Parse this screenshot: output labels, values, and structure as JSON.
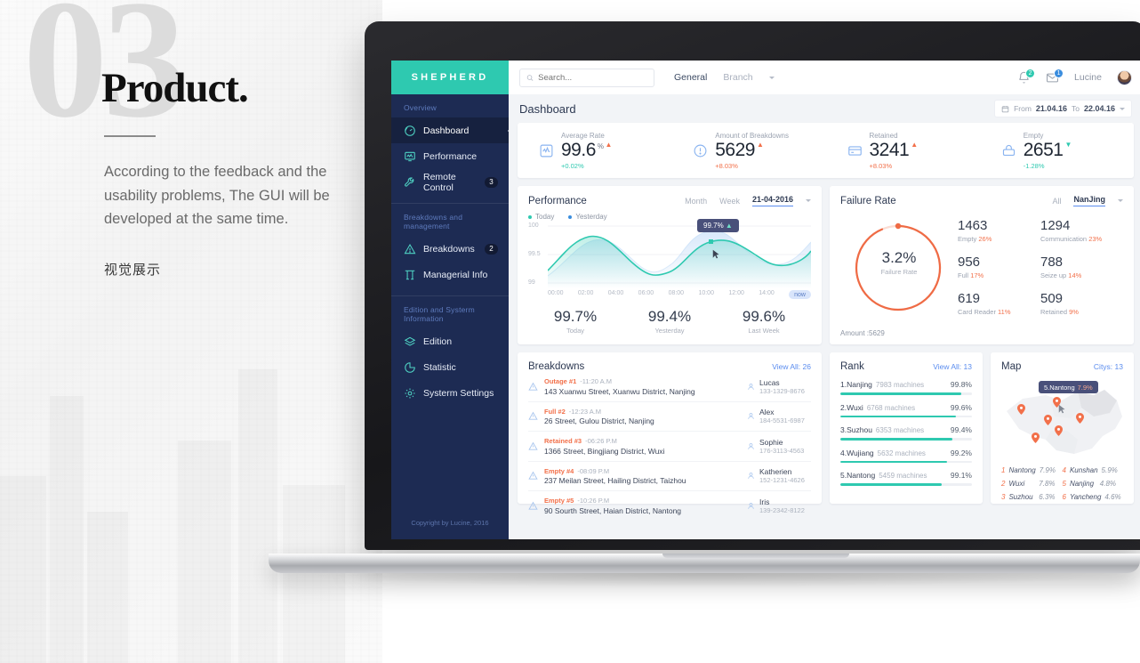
{
  "promo": {
    "number": "03",
    "title": "Product.",
    "body": "According to the feedback and the usability problems, The GUI will be developed at the same time.",
    "subtitle_cn": "视觉展示"
  },
  "sidebar": {
    "brand": "SHEPHERD",
    "groups": [
      {
        "label": "Overview",
        "items": [
          {
            "label": "Dashboard",
            "icon": "gauge-icon",
            "active": true,
            "badge": ""
          },
          {
            "label": "Performance",
            "icon": "monitor-chart-icon",
            "active": false,
            "badge": ""
          },
          {
            "label": "Remote Control",
            "icon": "wrench-icon",
            "active": false,
            "badge": "3"
          }
        ]
      },
      {
        "label": "Breakdowns and management",
        "items": [
          {
            "label": "Breakdowns",
            "icon": "warning-triangle-icon",
            "active": false,
            "badge": "2"
          },
          {
            "label": "Managerial Info",
            "icon": "columns-icon",
            "active": false,
            "badge": ""
          }
        ]
      },
      {
        "label": "Edition and Systerm Information",
        "items": [
          {
            "label": "Edition",
            "icon": "layers-icon",
            "active": false,
            "badge": ""
          },
          {
            "label": "Statistic",
            "icon": "pie-chart-icon",
            "active": false,
            "badge": ""
          },
          {
            "label": "Systerm Settings",
            "icon": "gear-icon",
            "active": false,
            "badge": ""
          }
        ]
      }
    ],
    "copyright": "Copyright by Lucine, 2016"
  },
  "topbar": {
    "search_placeholder": "Search...",
    "tabs": [
      {
        "label": "General",
        "active": true
      },
      {
        "label": "Branch",
        "active": false
      }
    ],
    "bell_badge": "2",
    "mail_badge": "1",
    "user": "Lucine"
  },
  "pagehead": {
    "title": "Dashboard",
    "from_label": "From",
    "from_value": "21.04.16",
    "to_label": "To",
    "to_value": "22.04.16"
  },
  "kpis": [
    {
      "label": "Average Rate",
      "value": "99.6",
      "unit": "%",
      "arrow": "▲",
      "arrow_color": "#f2704a",
      "delta": "+0.02%",
      "delta_color": "#2ec9b0",
      "icon": "pulse-box-icon"
    },
    {
      "label": "Amount of Breakdowns",
      "value": "5629",
      "unit": "",
      "arrow": "▲",
      "arrow_color": "#f2704a",
      "delta": "+8.03%",
      "delta_color": "#f2704a",
      "icon": "alert-circle-icon"
    },
    {
      "label": "Retained",
      "value": "3241",
      "unit": "",
      "arrow": "▲",
      "arrow_color": "#f2704a",
      "delta": "+8.03%",
      "delta_color": "#f2704a",
      "icon": "card-icon"
    },
    {
      "label": "Empty",
      "value": "2651",
      "unit": "",
      "arrow": "▼",
      "arrow_color": "#2ec9b0",
      "delta": "-1.28%",
      "delta_color": "#2ec9b0",
      "icon": "atm-icon"
    }
  ],
  "performance": {
    "title": "Performance",
    "segments": [
      {
        "label": "Month",
        "active": false
      },
      {
        "label": "Week",
        "active": false
      },
      {
        "label": "21-04-2016",
        "active": true
      }
    ],
    "legend": [
      {
        "label": "Today",
        "color": "#2ec9b0"
      },
      {
        "label": "Yesterday",
        "color": "#5b8def"
      }
    ],
    "tooltip": "99.7%",
    "tooltip_arrow": "▲",
    "now_label": "now",
    "stats": [
      {
        "value": "99.7%",
        "label": "Today"
      },
      {
        "value": "99.4%",
        "label": "Yesterday"
      },
      {
        "value": "99.6%",
        "label": "Last Week"
      }
    ],
    "chart_data": {
      "type": "line",
      "title": "Performance",
      "xlabel": "",
      "ylabel": "",
      "ylim": [
        99,
        100
      ],
      "grid": true,
      "legend_position": "top-left",
      "ticks_y": [
        "100",
        "99.5",
        "99"
      ],
      "x": [
        "00:00",
        "02:00",
        "04:00",
        "06:00",
        "08:00",
        "10:00",
        "12:00",
        "14:00"
      ],
      "series": [
        {
          "name": "Today",
          "color": "#2ec9b0",
          "values": [
            99.32,
            99.68,
            99.82,
            99.7,
            99.42,
            99.28,
            99.55,
            99.73,
            99.8,
            99.76,
            99.56,
            99.4,
            99.43,
            99.52,
            99.66
          ]
        },
        {
          "name": "Yesterday",
          "color": "#5b8def",
          "values": [
            99.12,
            99.28,
            99.48,
            99.55,
            99.45,
            99.3,
            99.35,
            99.62,
            99.86,
            99.88,
            99.8,
            99.58,
            99.4,
            99.38,
            99.64
          ]
        }
      ],
      "annotation": {
        "label": "99.7%",
        "x": "10:00",
        "y": 99.7
      }
    }
  },
  "failure": {
    "title": "Failure Rate",
    "segments": [
      {
        "label": "All",
        "active": false
      },
      {
        "label": "NanJing",
        "active": true
      }
    ],
    "rate": "3.2%",
    "rate_label": "Failure Rate",
    "amount": "Amount :5629",
    "chart_data": {
      "type": "pie",
      "title": "Failure Rate",
      "center_value": "3.2%",
      "center_label": "Failure Rate",
      "total": 5629,
      "donut_fill_percent": 78,
      "categories": [
        "Empty",
        "Communication",
        "Full",
        "Seize up",
        "Card Reader",
        "Retained"
      ],
      "values": [
        1463,
        1294,
        956,
        788,
        619,
        509
      ],
      "percents": [
        "26%",
        "23%",
        "17%",
        "14%",
        "11%",
        "9%"
      ]
    },
    "items": [
      {
        "n": "1463",
        "cap": "Empty",
        "pct": "26%"
      },
      {
        "n": "1294",
        "cap": "Communication",
        "pct": "23%"
      },
      {
        "n": "956",
        "cap": "Full",
        "pct": "17%"
      },
      {
        "n": "788",
        "cap": "Seize up",
        "pct": "14%"
      },
      {
        "n": "619",
        "cap": "Card Reader",
        "pct": "11%"
      },
      {
        "n": "509",
        "cap": "Retained",
        "pct": "9%"
      }
    ]
  },
  "breakdowns": {
    "title": "Breakdowns",
    "view_all": "View All: 26",
    "rows": [
      {
        "type": "Outage #1",
        "time": "-11:20 A.M",
        "addr": "143 Xuanwu Street, Xuanwu District, Nanjing",
        "name": "Lucas",
        "phone": "133-1329-8676"
      },
      {
        "type": "Full #2",
        "time": "-12:23 A.M",
        "addr": "26 Street, Gulou District, Nanjing",
        "name": "Alex",
        "phone": "184-5531-6987"
      },
      {
        "type": "Retained #3",
        "time": "-06:26 P.M",
        "addr": "1366 Street, Bingjiang District, Wuxi",
        "name": "Sophie",
        "phone": "176-3113-4563"
      },
      {
        "type": "Empty #4",
        "time": "-08:09 P.M",
        "addr": "237 Meilan Street, Hailing District, Taizhou",
        "name": "Katherien",
        "phone": "152-1231-4626"
      },
      {
        "type": "Empty #5",
        "time": "-10:26 P.M",
        "addr": "90 Sourth Street, Haian District, Nantong",
        "name": "Iris",
        "phone": "139-2342-8122"
      }
    ]
  },
  "rank": {
    "title": "Rank",
    "view_all": "View All: 13",
    "chart_data": {
      "type": "bar",
      "title": "Rank",
      "categories": [
        "1.Nanjing",
        "2.Wuxi",
        "3.Suzhou",
        "4.Wujiang",
        "5.Nantong"
      ],
      "values": [
        99.8,
        99.6,
        99.4,
        99.2,
        99.1
      ],
      "machines": [
        7983,
        6768,
        6353,
        5632,
        5459
      ],
      "ylabel": "",
      "xlabel": ""
    },
    "rows": [
      {
        "name": "1.Nanjing",
        "machines": "7983 machines",
        "pct": "99.8%",
        "fill": 92
      },
      {
        "name": "2.Wuxi",
        "machines": "6768 machines",
        "pct": "99.6%",
        "fill": 88
      },
      {
        "name": "3.Suzhou",
        "machines": "6353 machines",
        "pct": "99.4%",
        "fill": 85
      },
      {
        "name": "4.Wujiang",
        "machines": "5632 machines",
        "pct": "99.2%",
        "fill": 81
      },
      {
        "name": "5.Nantong",
        "machines": "5459 machines",
        "pct": "99.1%",
        "fill": 77
      }
    ]
  },
  "map": {
    "title": "Map",
    "cities_count": "Citys: 13",
    "tooltip_label": "5.Nantong",
    "tooltip_pct": "7.9%",
    "legend": [
      {
        "rank": "1",
        "city": "Nantong",
        "pct": "7.9%"
      },
      {
        "rank": "4",
        "city": "Kunshan",
        "pct": "5.9%"
      },
      {
        "rank": "2",
        "city": "Wuxi",
        "pct": "7.8%"
      },
      {
        "rank": "5",
        "city": "Nanjing",
        "pct": "4.8%"
      },
      {
        "rank": "3",
        "city": "Suzhou",
        "pct": "6.3%"
      },
      {
        "rank": "6",
        "city": "Yancheng",
        "pct": "4.6%"
      }
    ]
  }
}
